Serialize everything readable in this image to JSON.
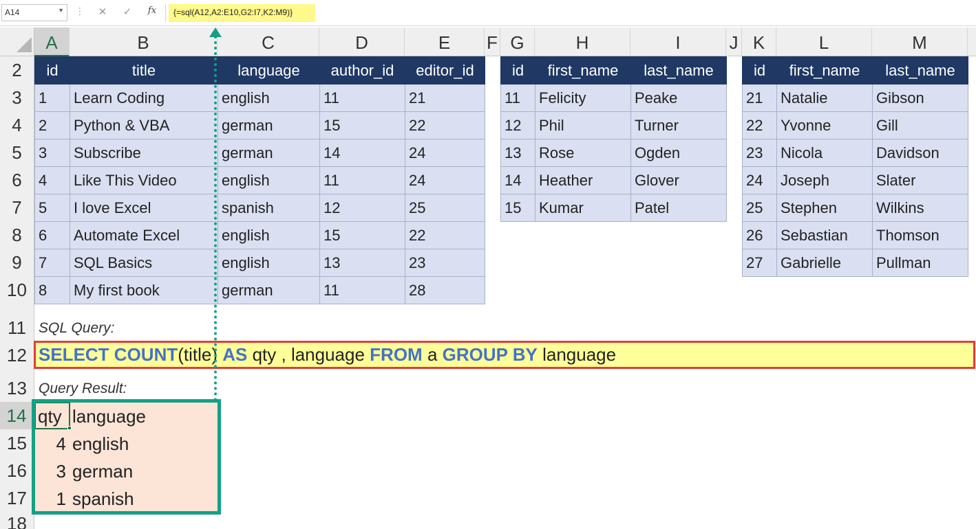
{
  "formula_bar": {
    "name_box": "A14",
    "cancel_icon": "✕",
    "enter_icon": "✓",
    "fx_label": "fx",
    "formula": "{=sql(A12,A2:E10,G2:I7,K2:M9)}"
  },
  "columns": [
    "A",
    "B",
    "C",
    "D",
    "E",
    "F",
    "G",
    "H",
    "I",
    "J",
    "K",
    "L",
    "M"
  ],
  "rows": [
    "2",
    "3",
    "4",
    "5",
    "6",
    "7",
    "8",
    "9",
    "10",
    "11",
    "12",
    "13",
    "14",
    "15",
    "16",
    "17",
    "18"
  ],
  "table_a": {
    "headers": [
      "id",
      "title",
      "language",
      "author_id",
      "editor_id"
    ],
    "rows": [
      [
        "1",
        "Learn Coding",
        "english",
        "11",
        "21"
      ],
      [
        "2",
        "Python & VBA",
        "german",
        "15",
        "22"
      ],
      [
        "3",
        "Subscribe",
        "german",
        "14",
        "24"
      ],
      [
        "4",
        "Like This Video",
        "english",
        "11",
        "24"
      ],
      [
        "5",
        "I love Excel",
        "spanish",
        "12",
        "25"
      ],
      [
        "6",
        "Automate Excel",
        "english",
        "15",
        "22"
      ],
      [
        "7",
        "SQL Basics",
        "english",
        "13",
        "23"
      ],
      [
        "8",
        "My first book",
        "german",
        "11",
        "28"
      ]
    ]
  },
  "table_authors": {
    "headers": [
      "id",
      "first_name",
      "last_name"
    ],
    "rows": [
      [
        "11",
        "Felicity",
        "Peake"
      ],
      [
        "12",
        "Phil",
        "Turner"
      ],
      [
        "13",
        "Rose",
        "Ogden"
      ],
      [
        "14",
        "Heather",
        "Glover"
      ],
      [
        "15",
        "Kumar",
        "Patel"
      ]
    ]
  },
  "table_editors": {
    "headers": [
      "id",
      "first_name",
      "last_name"
    ],
    "rows": [
      [
        "21",
        "Natalie",
        "Gibson"
      ],
      [
        "22",
        "Yvonne",
        "Gill"
      ],
      [
        "23",
        "Nicola",
        "Davidson"
      ],
      [
        "24",
        "Joseph",
        "Slater"
      ],
      [
        "25",
        "Stephen",
        "Wilkins"
      ],
      [
        "26",
        "Sebastian",
        "Thomson"
      ],
      [
        "27",
        "Gabrielle",
        "Pullman"
      ]
    ]
  },
  "sql_label": "SQL Query:",
  "sql_parts": [
    "SELECT COUNT",
    "(title) ",
    "AS",
    " qty , language ",
    "FROM",
    " a ",
    "GROUP BY",
    " language"
  ],
  "result_label": "Query Result:",
  "result": {
    "headers": [
      "qty",
      "language"
    ],
    "rows": [
      [
        "4",
        "english"
      ],
      [
        "3",
        "german"
      ],
      [
        "1",
        "spanish"
      ]
    ]
  },
  "colors": {
    "header_fill": "#1f3864",
    "body_fill": "#dae0f1",
    "query_fill": "#ffff99",
    "query_border": "#e03c3c",
    "result_fill": "#fce4d6",
    "result_border": "#12a086",
    "keyword": "#4472c4",
    "selection": "#217346"
  }
}
